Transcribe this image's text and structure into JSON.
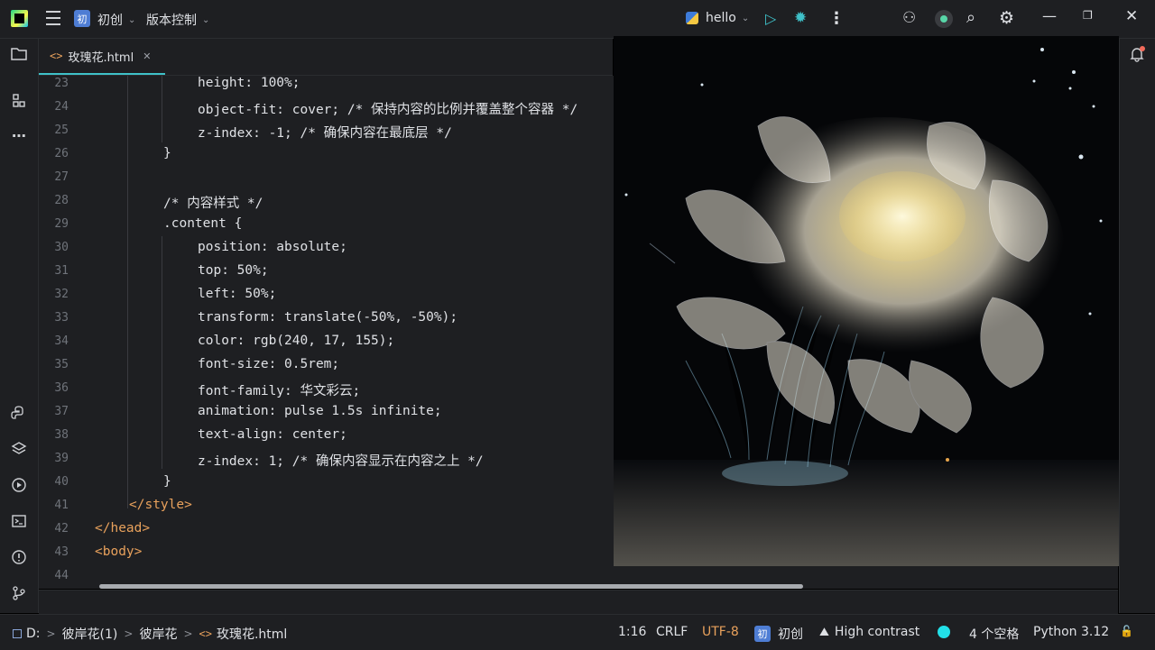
{
  "titlebar": {
    "project_badge": "初",
    "project_name": "初创",
    "vcs_label": "版本控制",
    "run_config": "hello",
    "run_icon": "▷",
    "debug_icon": "✹",
    "more_icon": "⋮",
    "user_icon": "⚇",
    "search_icon": "⌕",
    "gear_icon": "⚙",
    "minimize_icon": "—",
    "maximize_icon": "❐",
    "close_icon": "✕"
  },
  "tab": {
    "icon": "<>",
    "name": "玫瑰花.html",
    "close": "✕"
  },
  "editor": {
    "line_numbers": [
      "23",
      "24",
      "25",
      "26",
      "27",
      "28",
      "29",
      "30",
      "31",
      "32",
      "33",
      "34",
      "35",
      "36",
      "37",
      "38",
      "39",
      "40",
      "41",
      "42",
      "43",
      "44"
    ],
    "lines": [
      "height: 100%;",
      "object-fit: cover; /* 保持内容的比例并覆盖整个容器 */",
      "z-index: -1; /* 确保内容在最底层 */",
      "}",
      "",
      "/* 内容样式 */",
      ".content {",
      "position: absolute;",
      "top: 50%;",
      "left: 50%;",
      "transform: translate(-50%, -50%);",
      "color: rgb(240, 17, 155);",
      "font-size: 0.5rem;",
      "font-family: 华文彩云;",
      "animation: pulse 1.5s infinite;",
      "text-align: center;",
      "z-index: 1; /* 确保内容显示在内容之上 */",
      "}",
      "</style>",
      "</head>",
      "<body>",
      ""
    ]
  },
  "statusbar": {
    "drive": "D:",
    "crumb1": "彼岸花(1)",
    "crumb2": "彼岸花",
    "file_icon": "<>",
    "file": "玫瑰花.html",
    "sep": ">",
    "position": "1:16",
    "line_ending": "CRLF",
    "encoding": "UTF-8",
    "project_badge": "初",
    "project": "初创",
    "theme": "High contrast",
    "indent": "4 个空格",
    "interpreter": "Python 3.12",
    "lock_icon": "🔓"
  },
  "colors": {
    "accent": "#3fc1c9",
    "tag": "#e8a15c",
    "background": "#1e1f22"
  }
}
